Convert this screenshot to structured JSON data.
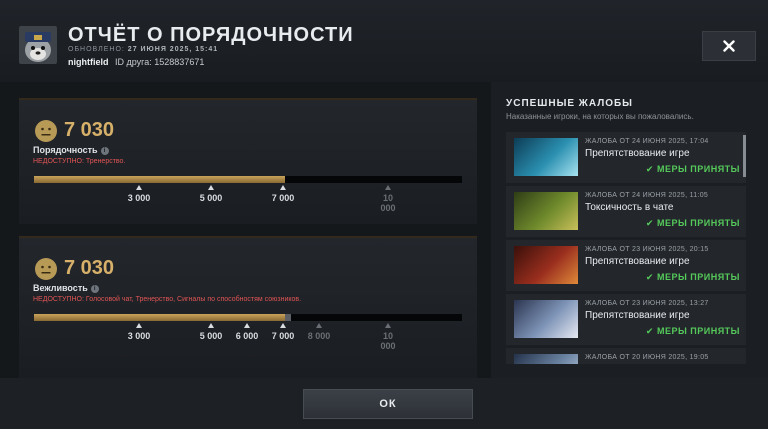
{
  "header": {
    "title": "ОТЧЁТ О ПОРЯДОЧНОСТИ",
    "updated_label": "ОБНОВЛЕНО:",
    "updated_value": "27 ИЮНЯ 2025, 15:41",
    "username": "nightfield",
    "friend_id_label": "ID друга:",
    "friend_id": "1528837671"
  },
  "conduct": {
    "score": "7 030",
    "label": "Порядочность",
    "unavail_label": "НЕДОСТУПНО:",
    "unavail_items": "Тренерство.",
    "progress_fraction": 0.586,
    "ticks": [
      {
        "label": "3 000",
        "active": true
      },
      {
        "label": "5 000",
        "active": true
      },
      {
        "label": "7 000",
        "active": true
      },
      {
        "label": "10 000",
        "active": false
      }
    ]
  },
  "politeness": {
    "score": "7 030",
    "label": "Вежливость",
    "unavail_label": "НЕДОСТУПНО:",
    "unavail_items": "Голосовой чат, Тренерство, Сигналы по способностям союзников.",
    "progress_fraction": 0.586,
    "ticks": [
      {
        "label": "3 000",
        "active": true
      },
      {
        "label": "5 000",
        "active": true
      },
      {
        "label": "6 000",
        "active": true
      },
      {
        "label": "7 000",
        "active": true
      },
      {
        "label": "8 000",
        "active": false
      },
      {
        "label": "10 000",
        "active": false
      }
    ]
  },
  "reports": {
    "title": "УСПЕШНЫЕ ЖАЛОБЫ",
    "subtitle": "Наказанные игроки, на которых вы пожаловались.",
    "items": [
      {
        "date": "ЖАЛОБА ОТ 24 ИЮНЯ 2025, 17:04",
        "reason": "Препятствование игре",
        "status": "МЕРЫ ПРИНЯТЫ",
        "thumb_color": "#2a8fb0"
      },
      {
        "date": "ЖАЛОБА ОТ 24 ИЮНЯ 2025, 11:05",
        "reason": "Токсичность в чате",
        "status": "МЕРЫ ПРИНЯТЫ",
        "thumb_color": "#6f8a2c"
      },
      {
        "date": "ЖАЛОБА ОТ 23 ИЮНЯ 2025, 20:15",
        "reason": "Препятствование игре",
        "status": "МЕРЫ ПРИНЯТЫ",
        "thumb_color": "#9a2e1e"
      },
      {
        "date": "ЖАЛОБА ОТ 23 ИЮНЯ 2025, 13:27",
        "reason": "Препятствование игре",
        "status": "МЕРЫ ПРИНЯТЫ",
        "thumb_color": "#7f95b8"
      },
      {
        "date": "ЖАЛОБА ОТ 20 ИЮНЯ 2025, 19:05",
        "reason": "",
        "status": "",
        "thumb_color": "#6d86a4"
      }
    ]
  },
  "footer": {
    "ok_label": "ОК"
  },
  "colors": {
    "accent_gold": "#d7b06a",
    "status_green": "#55c95a",
    "warning_red": "#e05454"
  }
}
